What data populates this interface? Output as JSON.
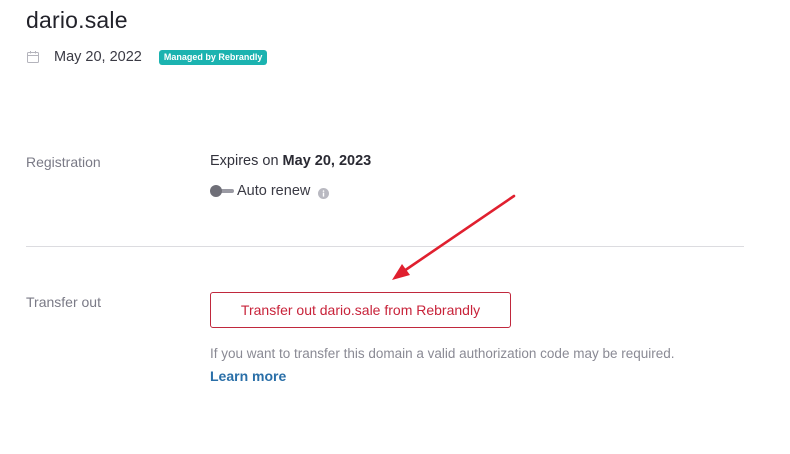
{
  "header": {
    "domain": "dario.sale",
    "date": "May 20, 2022",
    "badge": "Managed by Rebrandly",
    "calendar_icon": "calendar-icon"
  },
  "registration": {
    "label": "Registration",
    "expires_prefix": "Expires on",
    "expires_date": "May 20, 2023",
    "auto_renew_label": "Auto renew",
    "auto_renew_enabled": false,
    "info_icon": "info-icon"
  },
  "transfer": {
    "label": "Transfer out",
    "button_label": "Transfer out dario.sale from Rebrandly",
    "help_text": "If you want to transfer this domain a valid authorization code may be required.",
    "learn_more": "Learn more"
  },
  "annotation": {
    "arrow_icon": "red-arrow-annotation",
    "color": "#e0202f"
  },
  "colors": {
    "badge": "#1bb3b0",
    "danger": "#c8233a",
    "link": "#2a6fa8"
  }
}
